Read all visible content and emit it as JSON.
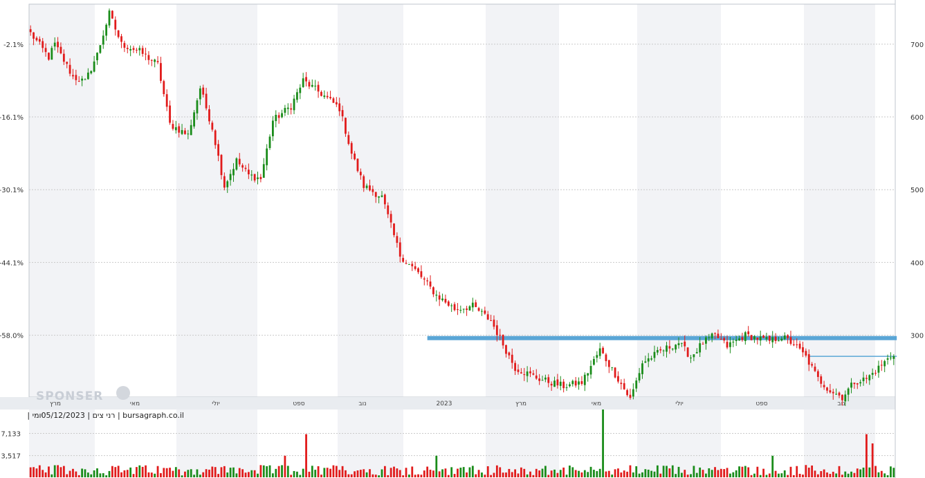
{
  "caption": "05/12/2023 | רני צים | bursagraph.co.il",
  "caption_suffix": "| יומי",
  "watermark": "SPONSER",
  "colors": {
    "up": "#1a8c1a",
    "down": "#e11b1b",
    "level": "#5aa6d6",
    "grid": "#c9c9c9",
    "band_light": "#f2f3f6",
    "band_white": "#ffffff",
    "strip": "#e9ecf0"
  },
  "chart_data": {
    "type": "candlestick",
    "x_labels": [
      "מרץ",
      "מאי",
      "יולי",
      "ספט",
      "נוב",
      "2023",
      "מרץ",
      "מאי",
      "יולי",
      "ספט",
      "נוב"
    ],
    "left_axis": {
      "ticks": [
        -2.1,
        -16.1,
        -30.1,
        -44.1,
        -58.0
      ],
      "labels": [
        "-2.1%",
        "-16.1%",
        "-30.1%",
        "-44.1%",
        "-58.0%"
      ]
    },
    "right_axis": {
      "ticks": [
        700,
        600,
        500,
        400,
        300
      ],
      "labels": [
        "700",
        "600",
        "500",
        "400",
        "300"
      ],
      "range": [
        215,
        755
      ]
    },
    "volume_axis": {
      "labels": [
        "7,133",
        "3,517"
      ],
      "ticks": [
        7133,
        3517
      ],
      "range": [
        0,
        11000
      ]
    },
    "resistance_levels": [
      {
        "value": 296,
        "from_index": 132,
        "to_index": 285,
        "style": "thick"
      },
      {
        "value": 271,
        "from_index": 258,
        "to_index": 285,
        "style": "thin"
      }
    ],
    "price_path": [
      [
        0,
        715
      ],
      [
        6,
        682
      ],
      [
        8,
        700
      ],
      [
        14,
        655
      ],
      [
        18,
        648
      ],
      [
        22,
        686
      ],
      [
        26,
        742
      ],
      [
        30,
        700
      ],
      [
        36,
        690
      ],
      [
        42,
        672
      ],
      [
        46,
        590
      ],
      [
        52,
        575
      ],
      [
        56,
        640
      ],
      [
        60,
        585
      ],
      [
        64,
        505
      ],
      [
        68,
        540
      ],
      [
        72,
        520
      ],
      [
        76,
        515
      ],
      [
        80,
        595
      ],
      [
        86,
        615
      ],
      [
        90,
        650
      ],
      [
        96,
        632
      ],
      [
        102,
        612
      ],
      [
        106,
        550
      ],
      [
        110,
        505
      ],
      [
        116,
        490
      ],
      [
        122,
        410
      ],
      [
        128,
        385
      ],
      [
        134,
        355
      ],
      [
        140,
        336
      ],
      [
        146,
        340
      ],
      [
        152,
        320
      ],
      [
        160,
        255
      ],
      [
        168,
        240
      ],
      [
        176,
        230
      ],
      [
        182,
        235
      ],
      [
        188,
        280
      ],
      [
        194,
        240
      ],
      [
        198,
        212
      ],
      [
        202,
        262
      ],
      [
        208,
        278
      ],
      [
        214,
        290
      ],
      [
        218,
        270
      ],
      [
        222,
        290
      ],
      [
        226,
        300
      ],
      [
        230,
        285
      ],
      [
        236,
        300
      ],
      [
        240,
        296
      ],
      [
        244,
        292
      ],
      [
        248,
        298
      ],
      [
        252,
        288
      ],
      [
        256,
        270
      ],
      [
        260,
        240
      ],
      [
        264,
        224
      ],
      [
        268,
        215
      ],
      [
        272,
        236
      ],
      [
        276,
        240
      ],
      [
        280,
        255
      ],
      [
        285,
        275
      ]
    ],
    "volume_spikes": [
      {
        "index": 84,
        "value": 3500
      },
      {
        "index": 91,
        "value": 7000
      },
      {
        "index": 134,
        "value": 3500
      },
      {
        "index": 189,
        "value": 11000
      },
      {
        "index": 245,
        "value": 3500
      },
      {
        "index": 276,
        "value": 7000
      },
      {
        "index": 278,
        "value": 5500
      }
    ]
  }
}
